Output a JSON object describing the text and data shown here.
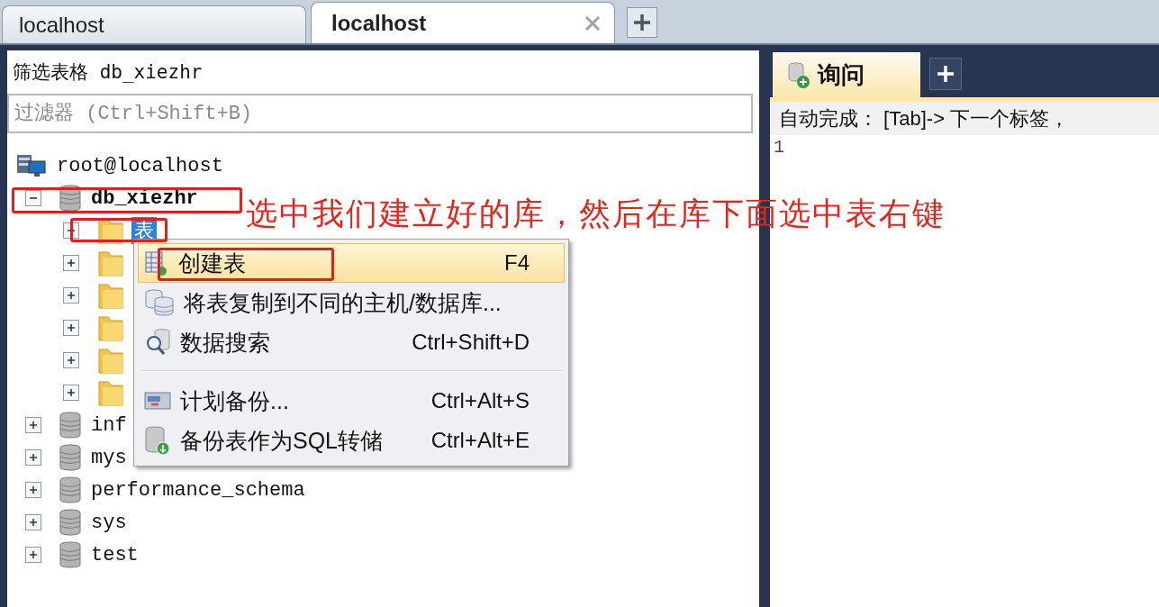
{
  "connection_tabs": [
    {
      "label": "localhost",
      "selected": false,
      "closable": false
    },
    {
      "label": "localhost",
      "selected": true,
      "closable": true
    }
  ],
  "sidebar": {
    "title": "筛选表格 db_xiezhr",
    "filter": {
      "placeholder": "过滤器 (Ctrl+Shift+B)"
    },
    "tree": [
      {
        "label": "root@localhost",
        "kind": "server",
        "selected": false,
        "children": [
          {
            "label": "db_xiezhr",
            "kind": "database",
            "expanded": true,
            "selected": false,
            "children": [
              {
                "label": "表",
                "kind": "folder",
                "expanded": false,
                "selected": true
              },
              {
                "kind": "folder",
                "expanded": false,
                "selected": false
              },
              {
                "kind": "folder",
                "expanded": false,
                "selected": false
              },
              {
                "kind": "folder",
                "expanded": false,
                "selected": false
              },
              {
                "kind": "folder",
                "expanded": false,
                "selected": false
              },
              {
                "kind": "folder",
                "expanded": false,
                "selected": false
              }
            ]
          },
          {
            "label": "inf",
            "kind": "database",
            "expanded": false,
            "selected": false
          },
          {
            "label": "mys",
            "kind": "database",
            "expanded": false,
            "selected": false
          },
          {
            "label": "performance_schema",
            "kind": "database",
            "expanded": false,
            "selected": false
          },
          {
            "label": "sys",
            "kind": "database",
            "expanded": false,
            "selected": false
          },
          {
            "label": "test",
            "kind": "database",
            "expanded": false,
            "selected": false
          }
        ]
      }
    ]
  },
  "context_menu": {
    "items": [
      {
        "kind": "item",
        "label": "创建表",
        "shortcut": "F4",
        "selected": true
      },
      {
        "kind": "item",
        "label": "将表复制到不同的主机/数据库...",
        "selected": false
      },
      {
        "kind": "item",
        "label": "数据搜索",
        "shortcut": "Ctrl+Shift+D",
        "selected": false
      },
      {
        "kind": "separator"
      },
      {
        "kind": "item",
        "label": "计划备份...",
        "shortcut": "Ctrl+Alt+S",
        "selected": false
      },
      {
        "kind": "item",
        "label": "备份表作为SQL转储",
        "shortcut": "Ctrl+Alt+E",
        "selected": false
      }
    ]
  },
  "annotation": {
    "text": "选中我们建立好的库，然后在库下面选中表右键"
  },
  "query": {
    "tabs": [
      {
        "label": "询问",
        "selected": true
      }
    ],
    "hint": "自动完成： [Tab]-> 下一个标签，",
    "line_numbers": [
      "1"
    ]
  }
}
